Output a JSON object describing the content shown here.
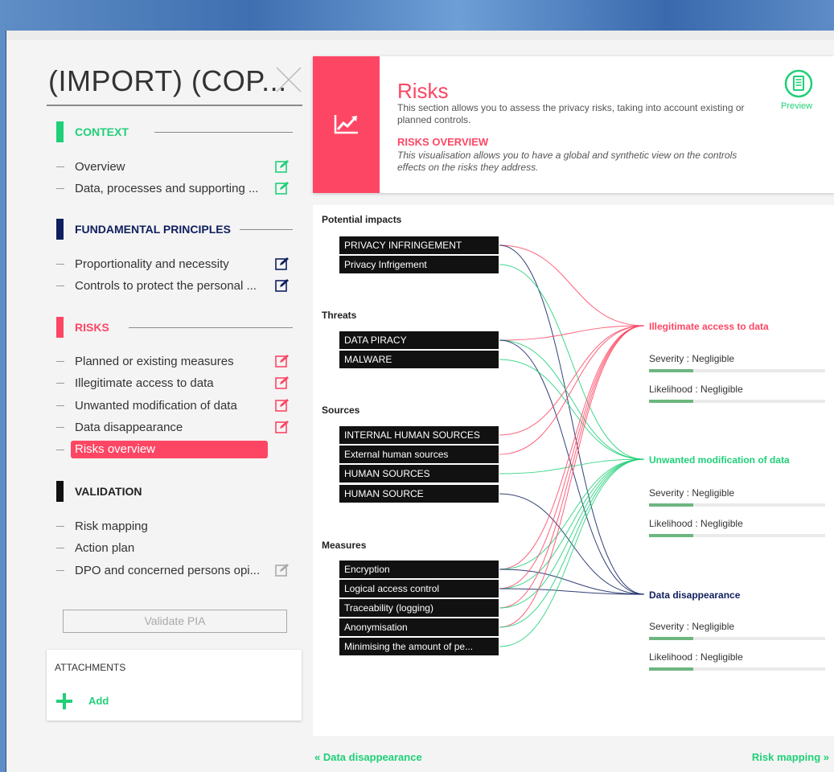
{
  "pia": {
    "title": "(IMPORT) (COP..."
  },
  "colors": {
    "red": "#fd4664",
    "green": "#1fd078",
    "navy": "#0f1f5e",
    "black": "#111111"
  },
  "sidebar": {
    "sections": [
      {
        "title": "CONTEXT",
        "color": "#1fd078",
        "items": [
          {
            "label": "Overview",
            "icon": "edit-icon"
          },
          {
            "label": "Data, processes and supporting ...",
            "icon": "edit-icon"
          }
        ]
      },
      {
        "title": "FUNDAMENTAL PRINCIPLES",
        "color": "#0f1f5e",
        "items": [
          {
            "label": "Proportionality and necessity",
            "icon": "edit-icon"
          },
          {
            "label": "Controls to protect the personal ...",
            "icon": "edit-icon"
          }
        ]
      },
      {
        "title": "RISKS",
        "color": "#fd4664",
        "items": [
          {
            "label": "Planned or existing measures",
            "icon": "edit-icon"
          },
          {
            "label": "Illegitimate access to data",
            "icon": "edit-icon"
          },
          {
            "label": "Unwanted modification of data",
            "icon": "edit-icon"
          },
          {
            "label": "Data disappearance",
            "icon": "edit-icon"
          },
          {
            "label": "Risks overview",
            "active": true
          }
        ]
      },
      {
        "title": "VALIDATION",
        "color": "#111111",
        "items": [
          {
            "label": "Risk mapping"
          },
          {
            "label": "Action plan"
          },
          {
            "label": "DPO and concerned persons opi...",
            "icon": "edit-icon"
          }
        ]
      }
    ],
    "validate_label": "Validate PIA",
    "attachments": {
      "title": "ATTACHMENTS",
      "add_label": "Add"
    }
  },
  "header": {
    "title": "Risks",
    "description": "This section allows you to assess the privacy risks, taking into account existing or planned controls.",
    "subtitle": "RISKS OVERVIEW",
    "subdescription": "This visualisation allows you to have a global and synthetic view on the controls effects on the risks they address.",
    "preview_label": "Preview"
  },
  "diagram": {
    "groups": [
      {
        "title": "Potential impacts",
        "items": [
          "PRIVACY INFRINGEMENT",
          "Privacy Infrigement"
        ]
      },
      {
        "title": "Threats",
        "items": [
          "DATA PIRACY",
          "MALWARE"
        ]
      },
      {
        "title": "Sources",
        "items": [
          "INTERNAL HUMAN SOURCES",
          "External human sources",
          "HUMAN SOURCES",
          "HUMAN SOURCE"
        ]
      },
      {
        "title": "Measures",
        "items": [
          "Encryption",
          "Logical access control",
          "Traceability (logging)",
          "Anonymisation",
          "Minimising the amount of pe..."
        ]
      }
    ],
    "risks": [
      {
        "title": "Illegitimate access to data",
        "color": "#fd4664",
        "severity": "Severity : Negligible",
        "likelihood": "Likelihood : Negligible",
        "severity_level": 0.25,
        "likelihood_level": 0.25
      },
      {
        "title": "Unwanted modification of data",
        "color": "#1fd078",
        "severity": "Severity : Negligible",
        "likelihood": "Likelihood : Negligible",
        "severity_level": 0.25,
        "likelihood_level": 0.25
      },
      {
        "title": "Data disappearance",
        "color": "#0f1f5e",
        "severity": "Severity : Negligible",
        "likelihood": "Likelihood : Negligible",
        "severity_level": 0.25,
        "likelihood_level": 0.25
      }
    ]
  },
  "footer": {
    "prev_label": "« Data disappearance",
    "next_label": "Risk mapping »"
  }
}
